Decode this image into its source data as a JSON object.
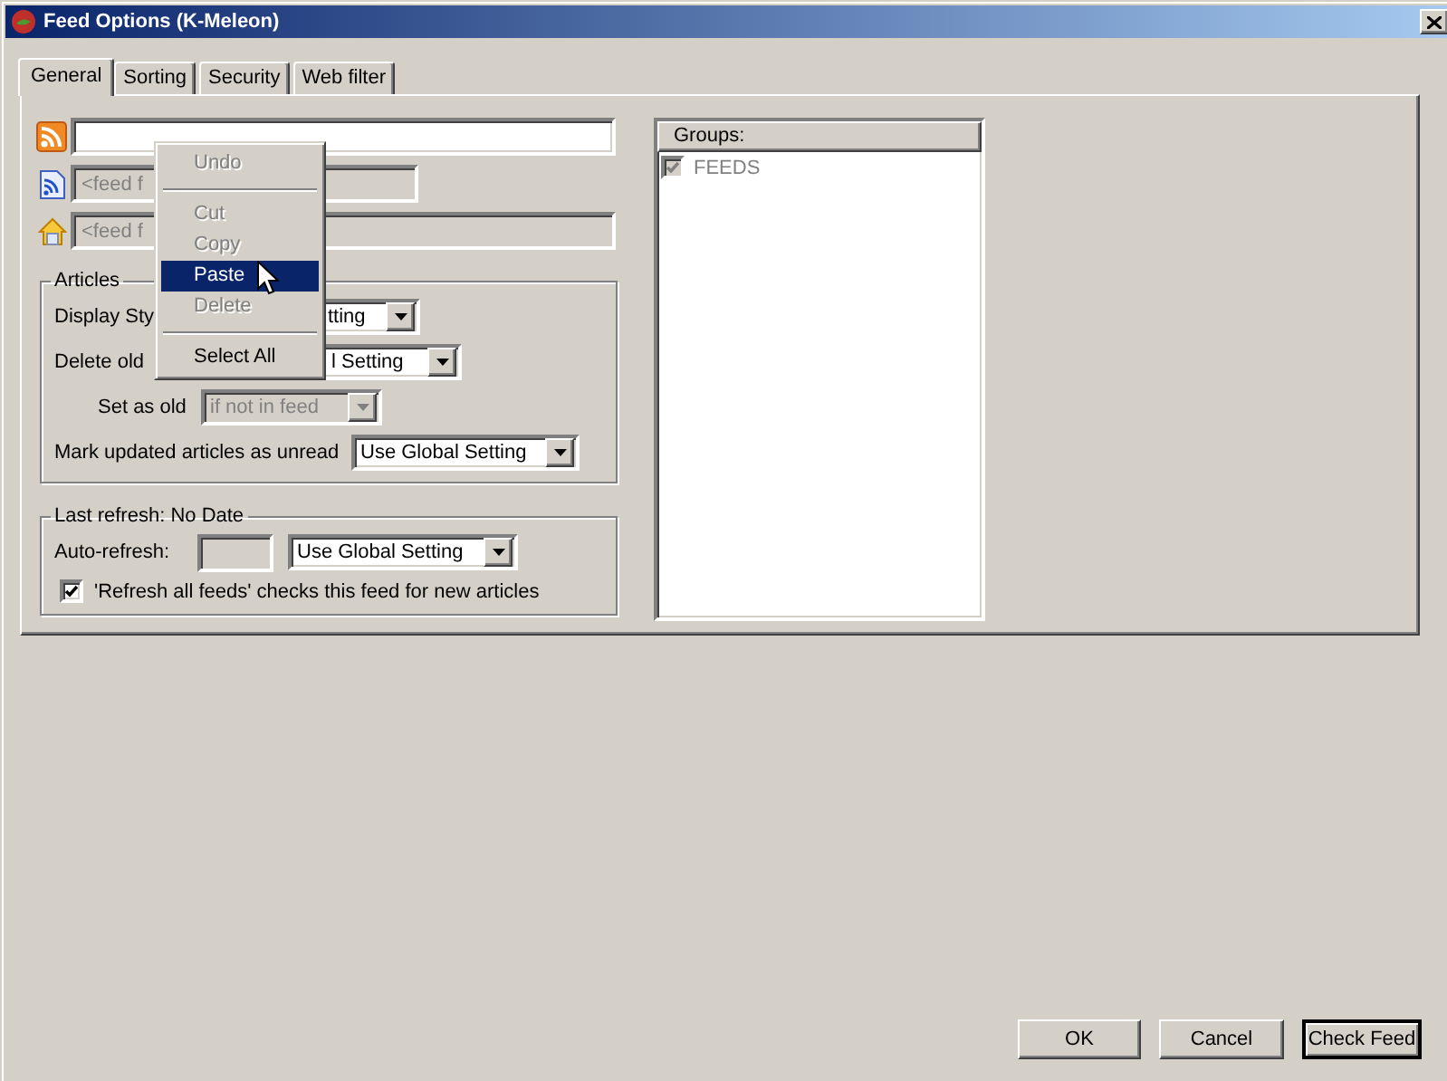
{
  "window": {
    "title": "Feed Options (K-Meleon)"
  },
  "tabs": [
    {
      "label": "General",
      "selected": true
    },
    {
      "label": "Sorting",
      "selected": false
    },
    {
      "label": "Security",
      "selected": false
    },
    {
      "label": "Web filter",
      "selected": false
    }
  ],
  "feed_fields": [
    {
      "kind": "rss",
      "disabled": false
    },
    {
      "kind": "feed_file",
      "value": "<feed f",
      "disabled": true
    },
    {
      "kind": "home",
      "value": "<feed f",
      "disabled": true
    }
  ],
  "articles": {
    "legend": "Articles",
    "rows": [
      {
        "label": "Display Sty",
        "value": "tting",
        "disabled": false
      },
      {
        "label": "Delete old",
        "value": "l Setting",
        "disabled": false
      },
      {
        "label": "Set as old",
        "value": "if not in feed",
        "disabled": true
      },
      {
        "label": "Mark updated articles as unread",
        "value": "Use Global Setting",
        "disabled": false
      }
    ]
  },
  "refresh": {
    "legend": "Last refresh: No Date",
    "label": "Auto-refresh:",
    "value": "Use Global Setting",
    "checkbox": {
      "label": "'Refresh all feeds' checks this feed for new articles",
      "checked": true
    }
  },
  "groups": {
    "header": "Groups:",
    "items": [
      {
        "label": "FEEDS",
        "checked": true,
        "disabled": true
      }
    ]
  },
  "context_menu": {
    "items": [
      {
        "kind": "item",
        "label": "Undo",
        "disabled": true,
        "selected": false
      },
      {
        "kind": "separator"
      },
      {
        "kind": "item",
        "label": "Cut",
        "disabled": true,
        "selected": false
      },
      {
        "kind": "item",
        "label": "Copy",
        "disabled": true,
        "selected": false
      },
      {
        "kind": "item",
        "label": "Paste",
        "disabled": false,
        "selected": true
      },
      {
        "kind": "item",
        "label": "Delete",
        "disabled": true,
        "selected": false
      },
      {
        "kind": "separator"
      },
      {
        "kind": "item",
        "label": "Select All",
        "disabled": false,
        "selected": false
      }
    ]
  },
  "buttons": [
    {
      "label": "OK",
      "default": false
    },
    {
      "label": "Cancel",
      "default": false
    },
    {
      "label": "Check Feed",
      "default": true
    }
  ]
}
